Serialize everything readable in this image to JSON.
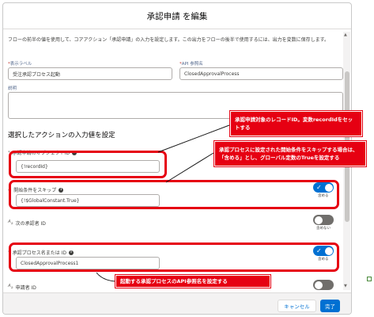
{
  "modal": {
    "title": "承認申請 を編集",
    "description": "フローの前半の値を使用して、コアアクション「承認申請」の入力を設定します。この出力をフローの後半で使用するには、出力を変数に保存します。"
  },
  "fields": {
    "display_label": {
      "label": "表示ラベル",
      "value": "受注承認プロセス起動"
    },
    "api_name": {
      "label": "API 参照名",
      "value": "ClosedApprovalProcess"
    },
    "description_label": "説明"
  },
  "section": {
    "title": "選択したアクションの入力値を設定"
  },
  "inputs": [
    {
      "label": "承認申請のオブジェクトID",
      "value": "{!recordId}",
      "toggle": null
    },
    {
      "label": "開始条件をスキップ",
      "value": "{!$GlobalConstant.True}",
      "toggle": "on",
      "toggle_caption": "含める"
    },
    {
      "label": "次の承認者 ID",
      "value": "",
      "toggle": "off",
      "toggle_caption": "含めない"
    },
    {
      "label": "承認プロセス名または ID",
      "value": "ClosedApprovalProcess1",
      "toggle": "on",
      "toggle_caption": "含める"
    },
    {
      "label": "申請者 ID",
      "value": "",
      "toggle": "off",
      "toggle_caption": "含めない"
    }
  ],
  "footer": {
    "cancel_label": "キャンセル",
    "done_label": "完了"
  },
  "annotations": {
    "callout_1": "承認申請対象のレコードID。変数recordIdをセットする",
    "callout_2": "承認プロセスに設定された開始条件をスキップする場合は、「含める」とし、グローバル定数のTrueを設定する",
    "callout_3": "起動する承認プロセスのAPI参照名を設定する"
  },
  "colors": {
    "accent": "#0070d2",
    "annotation_red": "#e60012",
    "toggle_off": "#706e6b"
  },
  "icons": {
    "info": "info-icon",
    "type": "text-type-icon",
    "check": "check-icon"
  }
}
